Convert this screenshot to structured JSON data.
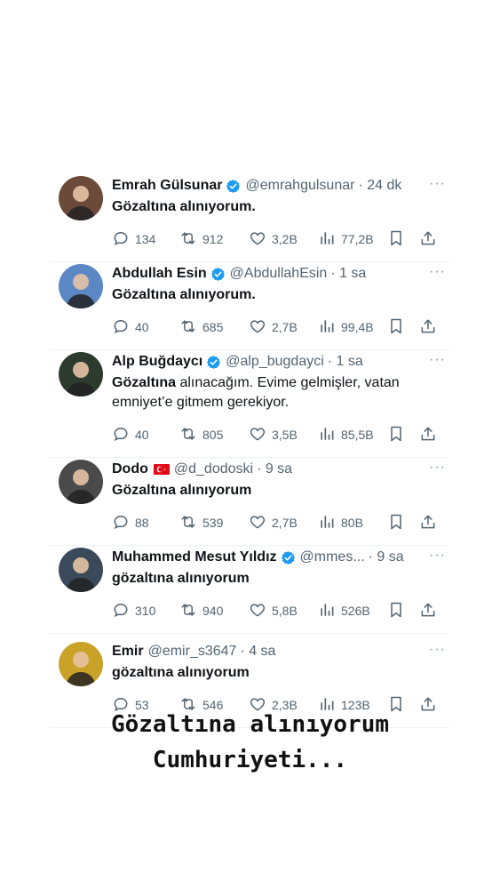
{
  "tweets": [
    {
      "name": "Emrah Gülsunar",
      "verified": true,
      "flag": false,
      "handle": "@emrahgulsunar",
      "time": "· 24 dk",
      "text_bold": "Gözaltına alınıyorum.",
      "text_rest": "",
      "replies": "134",
      "retweets": "912",
      "likes": "3,2B",
      "views": "77,2B",
      "avatar_color": "#6b4a3a"
    },
    {
      "name": "Abdullah Esin",
      "verified": true,
      "flag": false,
      "handle": "@AbdullahEsin",
      "time": "· 1 sa",
      "text_bold": "Gözaltına alınıyorum.",
      "text_rest": "",
      "replies": "40",
      "retweets": "685",
      "likes": "2,7B",
      "views": "99,4B",
      "avatar_color": "#5b87c4"
    },
    {
      "name": "Alp Buğdaycı",
      "verified": true,
      "flag": false,
      "handle": "@alp_bugdayci",
      "time": "· 1 sa",
      "text_bold": "Gözaltına",
      "text_rest": " alınacağım. Evime gelmişler, vatan emniyet’e gitmem gerekiyor.",
      "replies": "40",
      "retweets": "805",
      "likes": "3,5B",
      "views": "85,5B",
      "avatar_color": "#2c3b2e"
    },
    {
      "name": "Dodo",
      "verified": false,
      "flag": true,
      "handle": "@d_dodoski",
      "time": "· 9 sa",
      "text_bold": "Gözaltına alınıyorum",
      "text_rest": "",
      "replies": "88",
      "retweets": "539",
      "likes": "2,7B",
      "views": "80B",
      "avatar_color": "#4a4a4a"
    },
    {
      "name": "Muhammed Mesut Yıldız",
      "verified": true,
      "flag": false,
      "handle": "@mmes...",
      "time": "· 9 sa",
      "text_bold": "gözaltına alınıyorum",
      "text_rest": "",
      "replies": "310",
      "retweets": "940",
      "likes": "5,8B",
      "views": "526B",
      "avatar_color": "#3a4a5a"
    },
    {
      "name": "Emir",
      "verified": false,
      "flag": false,
      "handle": "@emir_s3647",
      "time": "· 4 sa",
      "text_bold": "gözaltına alınıyorum",
      "text_rest": "",
      "replies": "53",
      "retweets": "546",
      "likes": "2,3B",
      "views": "123B",
      "avatar_color": "#c9a227"
    }
  ],
  "caption": {
    "line1": "Gözaltına alınıyorum",
    "line2": "Cumhuriyeti..."
  },
  "colors": {
    "verified": "#1d9bf0",
    "secondary_text": "#536471",
    "flag": "#e30a17"
  },
  "icons": [
    "reply-icon",
    "retweet-icon",
    "like-icon",
    "views-icon",
    "bookmark-icon",
    "share-icon",
    "more-icon",
    "verified-badge-icon"
  ]
}
